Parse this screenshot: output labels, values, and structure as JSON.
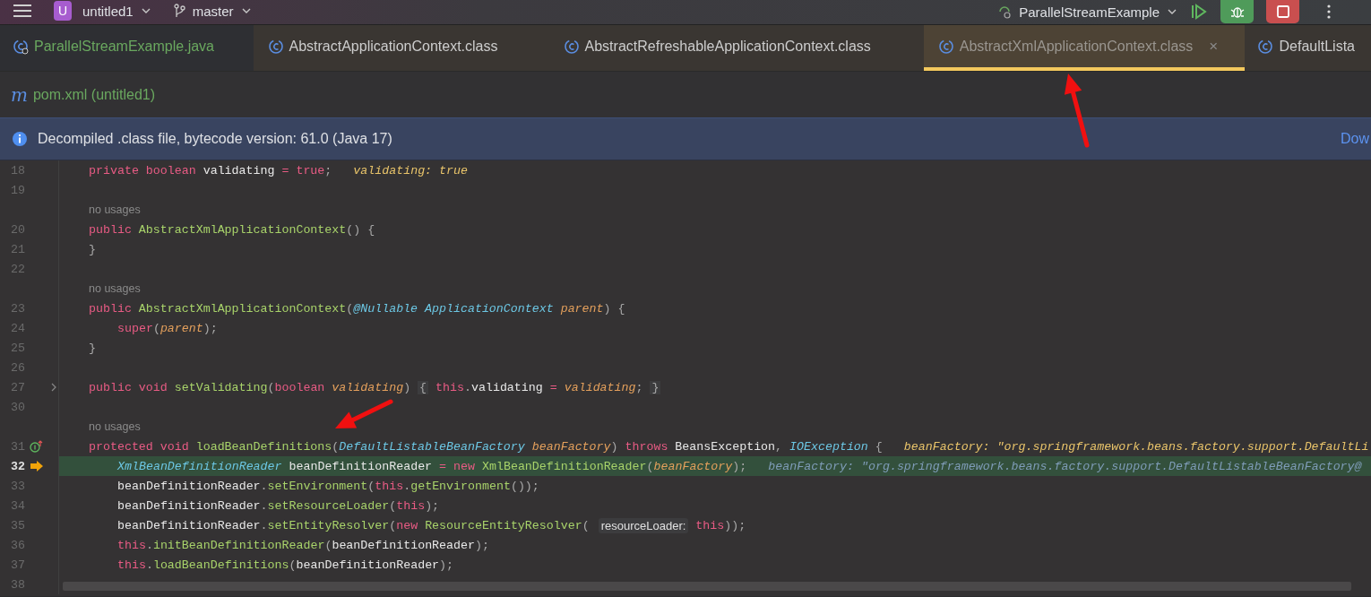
{
  "toolbar": {
    "project_badge": "U",
    "project": "untitled1",
    "branch": "master",
    "run_config": "ParallelStreamExample"
  },
  "tabs": [
    {
      "label": "ParallelStreamExample.java",
      "kind": "java",
      "selected": false
    },
    {
      "label": "AbstractApplicationContext.class",
      "kind": "class",
      "selected": false
    },
    {
      "label": "AbstractRefreshableApplicationContext.class",
      "kind": "class",
      "selected": false
    },
    {
      "label": "AbstractXmlApplicationContext.class",
      "kind": "class",
      "selected": true,
      "close": "×"
    },
    {
      "label": "DefaultLista",
      "kind": "class",
      "selected": false
    }
  ],
  "second_row_tab": {
    "icon": "m",
    "label": "pom.xml (untitled1)"
  },
  "banner": {
    "text": "Decompiled .class file, bytecode version: 61.0 (Java 17)",
    "link": "Dow"
  },
  "lines": [
    {
      "kind": "code",
      "number": "18",
      "parts": [
        {
          "kind": "code",
          "tokens": [
            {
              "kind": "kw",
              "text": "private boolean "
            },
            {
              "kind": "plain",
              "text": "validating "
            },
            {
              "kind": "kw",
              "text": "= true"
            },
            {
              "kind": "punct",
              "text": ";"
            }
          ]
        },
        {
          "kind": "value-hint",
          "text": "validating: true"
        }
      ]
    },
    {
      "kind": "code",
      "number": "19"
    },
    {
      "kind": "usage",
      "text": "no usages"
    },
    {
      "kind": "code",
      "number": "20",
      "parts": [
        {
          "kind": "code",
          "tokens": [
            {
              "kind": "kw",
              "text": "public "
            },
            {
              "kind": "fn",
              "text": "AbstractXmlApplicationContext"
            },
            {
              "kind": "punct",
              "text": "() {"
            }
          ]
        }
      ]
    },
    {
      "kind": "code",
      "number": "21",
      "parts": [
        {
          "kind": "code",
          "tokens": [
            {
              "kind": "punct",
              "text": "}"
            }
          ]
        }
      ]
    },
    {
      "kind": "code",
      "number": "22"
    },
    {
      "kind": "usage",
      "text": "no usages"
    },
    {
      "kind": "code",
      "number": "23",
      "parts": [
        {
          "kind": "code",
          "tokens": [
            {
              "kind": "kw",
              "text": "public "
            },
            {
              "kind": "fn",
              "text": "AbstractXmlApplicationContext"
            },
            {
              "kind": "punct",
              "text": "("
            },
            {
              "kind": "type",
              "text": "@Nullable ApplicationContext "
            },
            {
              "kind": "param",
              "text": "parent"
            },
            {
              "kind": "punct",
              "text": ") {"
            }
          ]
        }
      ]
    },
    {
      "kind": "code",
      "number": "24",
      "indent": true,
      "parts": [
        {
          "kind": "code",
          "tokens": [
            {
              "kind": "kw",
              "text": "super"
            },
            {
              "kind": "punct",
              "text": "("
            },
            {
              "kind": "param",
              "text": "parent"
            },
            {
              "kind": "punct",
              "text": ");"
            }
          ]
        }
      ]
    },
    {
      "kind": "code",
      "number": "25",
      "parts": [
        {
          "kind": "code",
          "tokens": [
            {
              "kind": "punct",
              "text": "}"
            }
          ]
        }
      ]
    },
    {
      "kind": "code",
      "number": "26"
    },
    {
      "kind": "code",
      "number": "27",
      "gutter_icon": {
        "kind": "fold"
      },
      "parts": [
        {
          "kind": "code",
          "tokens": [
            {
              "kind": "kw",
              "text": "public void "
            },
            {
              "kind": "fn",
              "text": "setValidating"
            },
            {
              "kind": "punct",
              "text": "("
            },
            {
              "kind": "kw",
              "text": "boolean "
            },
            {
              "kind": "param",
              "text": "validating"
            },
            {
              "kind": "punct",
              "text": ") "
            },
            {
              "kind": "fold",
              "text": "{"
            },
            {
              "kind": "kw",
              "text": " this"
            },
            {
              "kind": "punct",
              "text": "."
            },
            {
              "kind": "plain",
              "text": "validating "
            },
            {
              "kind": "kw",
              "text": "= "
            },
            {
              "kind": "param",
              "text": "validating"
            },
            {
              "kind": "punct",
              "text": "; "
            },
            {
              "kind": "fold",
              "text": "}"
            }
          ]
        }
      ]
    },
    {
      "kind": "code",
      "number": "30"
    },
    {
      "kind": "usage",
      "text": "no usages"
    },
    {
      "kind": "code",
      "number": "31",
      "gutter_icon": {
        "kind": "implements"
      },
      "parts": [
        {
          "kind": "code",
          "tokens": [
            {
              "kind": "kw",
              "text": "protected void "
            },
            {
              "kind": "fn",
              "text": "loadBeanDefinitions"
            },
            {
              "kind": "punct",
              "text": "("
            },
            {
              "kind": "type",
              "text": "DefaultListableBeanFactory "
            },
            {
              "kind": "param",
              "text": "beanFactory"
            },
            {
              "kind": "punct",
              "text": ") "
            },
            {
              "kind": "kw",
              "text": "throws "
            },
            {
              "kind": "plain",
              "text": "BeansException"
            },
            {
              "kind": "punct",
              "text": ", "
            },
            {
              "kind": "type",
              "text": "IOException "
            },
            {
              "kind": "punct",
              "text": "{"
            }
          ]
        },
        {
          "kind": "value-hint",
          "text": "beanFactory: \"org.springframework.beans.factory.support.DefaultLi"
        }
      ]
    },
    {
      "kind": "code",
      "number": "32",
      "gutter_icon": {
        "kind": "execution-point"
      },
      "current": true,
      "indent": true,
      "parts": [
        {
          "kind": "code",
          "tokens": [
            {
              "kind": "type",
              "text": "XmlBeanDefinitionReader "
            },
            {
              "kind": "plain",
              "text": "beanDefinitionReader "
            },
            {
              "kind": "kw",
              "text": "= new "
            },
            {
              "kind": "fn",
              "text": "XmlBeanDefinitionReader"
            },
            {
              "kind": "punct",
              "text": "("
            },
            {
              "kind": "param",
              "text": "beanFactory"
            },
            {
              "kind": "punct",
              "text": ");"
            }
          ]
        },
        {
          "kind": "debug-hint",
          "text": "beanFactory: \"org.springframework.beans.factory.support.DefaultListableBeanFactory@"
        }
      ]
    },
    {
      "kind": "code",
      "number": "33",
      "indent": true,
      "parts": [
        {
          "kind": "code",
          "tokens": [
            {
              "kind": "plain",
              "text": "beanDefinitionReader"
            },
            {
              "kind": "punct",
              "text": "."
            },
            {
              "kind": "fn",
              "text": "setEnvironment"
            },
            {
              "kind": "punct",
              "text": "("
            },
            {
              "kind": "kw",
              "text": "this"
            },
            {
              "kind": "punct",
              "text": "."
            },
            {
              "kind": "fn",
              "text": "getEnvironment"
            },
            {
              "kind": "punct",
              "text": "());"
            }
          ]
        }
      ]
    },
    {
      "kind": "code",
      "number": "34",
      "indent": true,
      "parts": [
        {
          "kind": "code",
          "tokens": [
            {
              "kind": "plain",
              "text": "beanDefinitionReader"
            },
            {
              "kind": "punct",
              "text": "."
            },
            {
              "kind": "fn",
              "text": "setResourceLoader"
            },
            {
              "kind": "punct",
              "text": "("
            },
            {
              "kind": "kw",
              "text": "this"
            },
            {
              "kind": "punct",
              "text": ");"
            }
          ]
        }
      ]
    },
    {
      "kind": "code",
      "number": "35",
      "indent": true,
      "parts": [
        {
          "kind": "code",
          "tokens": [
            {
              "kind": "plain",
              "text": "beanDefinitionReader"
            },
            {
              "kind": "punct",
              "text": "."
            },
            {
              "kind": "fn",
              "text": "setEntityResolver"
            },
            {
              "kind": "punct",
              "text": "("
            },
            {
              "kind": "kw",
              "text": "new "
            },
            {
              "kind": "fn",
              "text": "ResourceEntityResolver"
            },
            {
              "kind": "punct",
              "text": "( "
            }
          ]
        },
        {
          "kind": "param-hint",
          "text": "resourceLoader:"
        },
        {
          "kind": "code",
          "tokens": [
            {
              "kind": "kw",
              "text": " this"
            },
            {
              "kind": "punct",
              "text": "));"
            }
          ]
        }
      ]
    },
    {
      "kind": "code",
      "number": "36",
      "indent": true,
      "parts": [
        {
          "kind": "code",
          "tokens": [
            {
              "kind": "kw",
              "text": "this"
            },
            {
              "kind": "punct",
              "text": "."
            },
            {
              "kind": "fn",
              "text": "initBeanDefinitionReader"
            },
            {
              "kind": "punct",
              "text": "("
            },
            {
              "kind": "plain",
              "text": "beanDefinitionReader"
            },
            {
              "kind": "punct",
              "text": ");"
            }
          ]
        }
      ]
    },
    {
      "kind": "code",
      "number": "37",
      "indent": true,
      "parts": [
        {
          "kind": "code",
          "tokens": [
            {
              "kind": "kw",
              "text": "this"
            },
            {
              "kind": "punct",
              "text": "."
            },
            {
              "kind": "fn",
              "text": "loadBeanDefinitions"
            },
            {
              "kind": "punct",
              "text": "("
            },
            {
              "kind": "plain",
              "text": "beanDefinitionReader"
            },
            {
              "kind": "punct",
              "text": ");"
            }
          ]
        }
      ]
    },
    {
      "kind": "code",
      "number": "38"
    }
  ],
  "annotations": [
    {
      "kind": "arrow"
    },
    {
      "kind": "arrow"
    }
  ]
}
